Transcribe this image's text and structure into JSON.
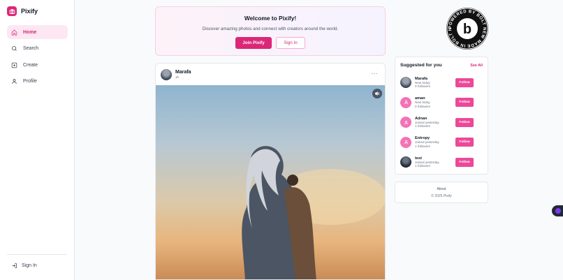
{
  "app": {
    "name": "Pixify",
    "accent": "#db2777"
  },
  "sidebar": {
    "items": [
      {
        "label": "Home",
        "icon": "home-icon",
        "active": true
      },
      {
        "label": "Search",
        "icon": "search-icon",
        "active": false
      },
      {
        "label": "Create",
        "icon": "plus-square-icon",
        "active": false
      },
      {
        "label": "Profile",
        "icon": "user-icon",
        "active": false
      }
    ],
    "signin_label": "Sign In"
  },
  "welcome": {
    "title": "Welcome to Pixify!",
    "subtitle": "Discover amazing photos and connect with creators around the world.",
    "join_label": "Join Pixify",
    "signin_label": "Sign In"
  },
  "post": {
    "author": "Marafa",
    "time": "1h",
    "more_label": "···"
  },
  "suggested": {
    "title": "Suggested for you",
    "see_all": "See All",
    "follow_label": "Follow",
    "users": [
      {
        "name": "Marafa",
        "joined": "New today",
        "followers": "0 followers",
        "avatar": "photo"
      },
      {
        "name": "aman",
        "joined": "New today",
        "followers": "0 followers",
        "avatar": "placeholder"
      },
      {
        "name": "Adnan",
        "joined": "Joined yesterday",
        "followers": "1 followers",
        "avatar": "placeholder"
      },
      {
        "name": "Entropy",
        "joined": "Joined yesterday",
        "followers": "1 followers",
        "avatar": "placeholder"
      },
      {
        "name": "test",
        "joined": "Joined yesterday",
        "followers": "1 followers",
        "avatar": "dark"
      }
    ]
  },
  "about": {
    "link": "About",
    "copyright": "© 2025 Pixify"
  },
  "badge": {
    "text": "POWERED BY BOLT NEW MADE IN BOLT NEW",
    "letter": "b"
  }
}
